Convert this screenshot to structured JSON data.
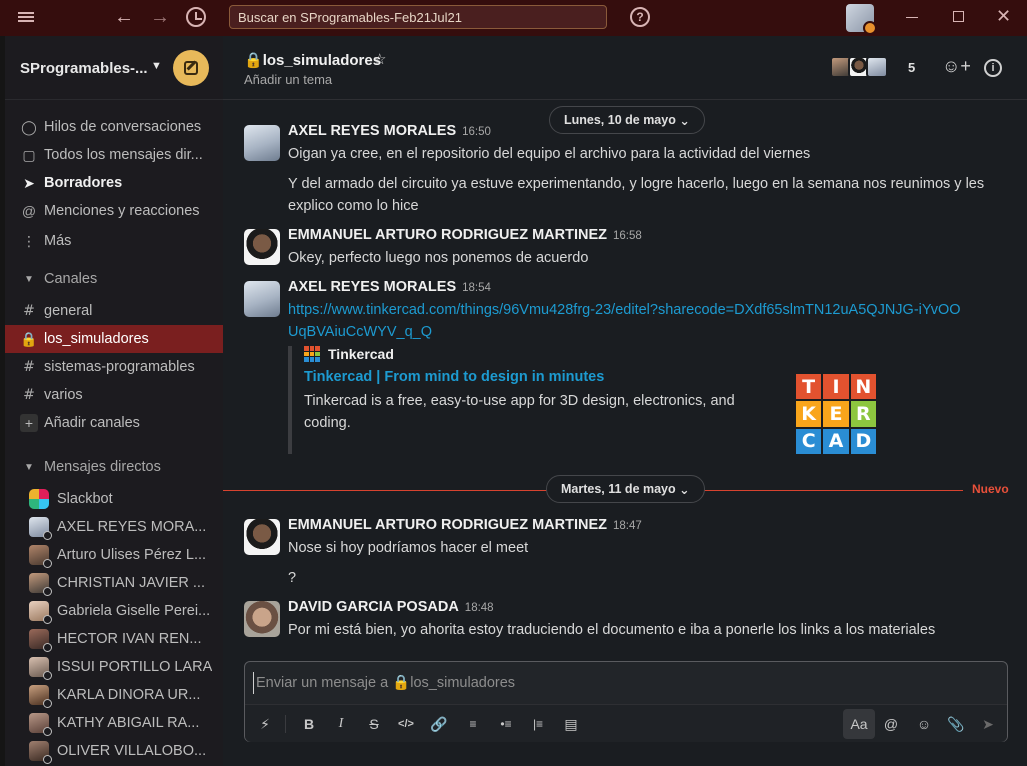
{
  "titlebar": {
    "search_placeholder": "Buscar en SProgramables-Feb21Jul21"
  },
  "sidebar": {
    "workspace_name": "SProgramables-...",
    "nav": [
      {
        "label": "Hilos de conversaciones",
        "icon": "threads-icon"
      },
      {
        "label": "Todos los mensajes dir...",
        "icon": "dm-icon"
      },
      {
        "label": "Borradores",
        "icon": "drafts-icon"
      },
      {
        "label": "Menciones y reacciones",
        "icon": "mention-icon"
      },
      {
        "label": "Más",
        "icon": "more-icon"
      }
    ],
    "channels_section": "Canales",
    "channels": [
      "general",
      "los_simuladores",
      "sistemas-programables",
      "varios"
    ],
    "add_channels": "Añadir canales",
    "dm_section": "Mensajes directos",
    "dms": [
      "Slackbot",
      "AXEL REYES MORA...",
      "Arturo Ulises Pérez L...",
      "CHRISTIAN JAVIER ...",
      "Gabriela Giselle Perei...",
      "HECTOR IVAN REN...",
      "ISSUI PORTILLO LARA",
      "KARLA DINORA UR...",
      "KATHY ABIGAIL RA...",
      "OLIVER VILLALOBO..."
    ]
  },
  "channel": {
    "name": "los_simuladores",
    "topic": "Añadir un tema",
    "member_count": "5"
  },
  "dates": {
    "first": "Lunes, 10 de mayo",
    "second": "Martes, 11 de mayo",
    "new_label": "Nuevo"
  },
  "messages": [
    {
      "author": "AXEL REYES MORALES",
      "time": "16:50",
      "lines": [
        "Oigan ya cree, en el repositorio del equipo el archivo para la actividad del viernes",
        "Y del armado del circuito ya estuve experimentando, y logre hacerlo, luego en la semana nos reunimos y les explico como lo hice"
      ]
    },
    {
      "author": "EMMANUEL ARTURO RODRIGUEZ MARTINEZ",
      "time": "16:58",
      "lines": [
        "Okey, perfecto luego nos ponemos de acuerdo"
      ]
    },
    {
      "author": "AXEL REYES MORALES",
      "time": "18:54",
      "link": "https://www.tinkercad.com/things/96Vmu428frg-23/editel?sharecode=DXdf65slmTN12uA5QJNJG-iYvOOUqBVAiuCcWYV_q_Q"
    },
    {
      "author": "EMMANUEL ARTURO RODRIGUEZ MARTINEZ",
      "time": "18:47",
      "lines": [
        "Nose si hoy podríamos hacer el meet",
        "?"
      ]
    },
    {
      "author": "DAVID GARCIA POSADA",
      "time": "18:48",
      "lines": [
        "Por mi está bien, yo ahorita estoy traduciendo el documento e iba a ponerle los links a los materiales"
      ]
    }
  ],
  "unfurl": {
    "site": "Tinkercad",
    "title": "Tinkercad | From mind to design in minutes",
    "description": "Tinkercad is a free, easy-to-use app for 3D design, electronics, and coding.",
    "logo_letters": [
      "T",
      "I",
      "N",
      "K",
      "E",
      "R",
      "C",
      "A",
      "D"
    ],
    "logo_colors": [
      "#e2522f",
      "#e2522f",
      "#e2522f",
      "#f9a51b",
      "#f9a51b",
      "#8dc63f",
      "#2a8dd4",
      "#2a8dd4",
      "#2a8dd4"
    ]
  },
  "composer": {
    "placeholder": "Enviar un mensaje a 🔒los_simuladores",
    "format_label": "Aa"
  },
  "colors": {
    "titlebar": "#350d0d",
    "active_channel": "#7a1f1f",
    "compose_button": "#e8b95a",
    "link": "#1d9bd1",
    "new_divider": "#d7432f"
  }
}
